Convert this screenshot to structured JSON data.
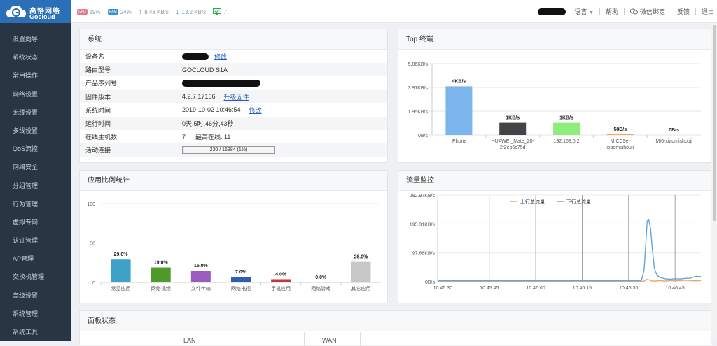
{
  "brand": {
    "name_cn": "高恪网络",
    "name_en": "Gocloud"
  },
  "header_stats": {
    "cpu_badge": "CPU",
    "cpu": "19%",
    "ram_badge": "RAM",
    "ram": "24%",
    "upload": "8.43 KB/s",
    "download": "13.2 KB/s",
    "hosts": "7"
  },
  "top_nav": {
    "language": "语言",
    "help": "帮助",
    "wechat": "微信绑定",
    "feedback": "反馈",
    "logout": "退出"
  },
  "sidebar": {
    "items": [
      "设置向导",
      "系统状态",
      "常用操作",
      "网络设置",
      "无线设置",
      "多线设置",
      "QoS流控",
      "网络安全",
      "分组管理",
      "行为管理",
      "虚拟专网",
      "认证管理",
      "AP管理",
      "交换机管理",
      "高级设置",
      "系统管理",
      "系统工具"
    ]
  },
  "system_panel": {
    "title": "系统",
    "rows": [
      {
        "key": "设备名",
        "value": "",
        "link": "修改"
      },
      {
        "key": "路由型号",
        "value": "GOCLOUD S1A"
      },
      {
        "key": "产品序列号",
        "value": ""
      },
      {
        "key": "固件版本",
        "value": "4.2.7.17166",
        "link": "升级固件"
      },
      {
        "key": "系统时间",
        "value": "2019-10-02 10:46:54",
        "link": "修改"
      },
      {
        "key": "运行时间",
        "value": "0天,5时,46分,43秒"
      },
      {
        "key": "在线主机数",
        "value": "7",
        "extra": "最高在线: 11"
      },
      {
        "key": "活动连接",
        "value": "230 / 16384 (1%)",
        "progress": 0.014
      }
    ]
  },
  "top_terminals": {
    "title": "Top 终端",
    "chart_data": {
      "type": "bar",
      "categories": [
        "iPhone",
        "HUAWEI_Mate_20-2f2eb6c75d",
        "192.168.0.2",
        "MICC9e-xiaomishouji",
        "MI6-xiaomishouji"
      ],
      "category_lines": [
        [
          "iPhone"
        ],
        [
          "HUAWEI_Mate_20-",
          "2f2eb6c75d"
        ],
        [
          "192.168.0.2"
        ],
        [
          "MICC9e-",
          "xiaomishouji"
        ],
        [
          "MI6-xiaomishouji"
        ]
      ],
      "values": [
        4,
        1,
        1,
        0.057,
        0
      ],
      "data_labels": [
        "4KB/s",
        "1KB/s",
        "1KB/s",
        "58B/s",
        "0B/s"
      ],
      "yticks": [
        "0B/s",
        "1.95KB/s",
        "3.91KB/s",
        "5.86KB/s"
      ],
      "ylim": [
        0,
        5.86
      ],
      "colors": [
        "#7cb5ec",
        "#434348",
        "#90ed7d",
        "#f7a35c",
        "#8085e9"
      ]
    }
  },
  "app_stats": {
    "title": "应用比例统计",
    "chart_data": {
      "type": "bar",
      "categories": [
        "常见应用",
        "网络视频",
        "文件传输",
        "网络电视",
        "手机应用",
        "网络游戏",
        "其它应用"
      ],
      "values": [
        29.0,
        19.0,
        15.0,
        7.0,
        4.0,
        0.0,
        26.0
      ],
      "data_labels": [
        "29.0%",
        "19.0%",
        "15.0%",
        "7.0%",
        "4.0%",
        "0.0%",
        "26.0%"
      ],
      "yticks": [
        "0",
        "50",
        "100"
      ],
      "ylim": [
        0,
        100
      ],
      "colors": [
        "#3ea1c7",
        "#4e9a2a",
        "#9b5bbf",
        "#2d5fae",
        "#c0393b",
        "#999999",
        "#c7c7c7"
      ]
    }
  },
  "traffic": {
    "title": "流量监控",
    "chart_data": {
      "type": "line",
      "legend": [
        "上行总流量",
        "下行总流量"
      ],
      "legend_placement": "top-center",
      "x_ticks": [
        "10:45:30",
        "10:45:45",
        "10:46:00",
        "10:46:15",
        "10:46:30",
        "10:46:45"
      ],
      "yticks": [
        "0B/s",
        "97.66KB/s",
        "195.31KB/s",
        "292.97KB/s"
      ],
      "ylim": [
        0,
        292.97
      ],
      "series": [
        {
          "name": "上行总流量",
          "color": "#f7a35c",
          "x": [
            0,
            3,
            6,
            9,
            12,
            15,
            18,
            21,
            24,
            27,
            30,
            33,
            36,
            39,
            42,
            45,
            48,
            51,
            54,
            57,
            60,
            63,
            66,
            69,
            72,
            75,
            78,
            80,
            81,
            82,
            83,
            84,
            85,
            86,
            87,
            88,
            89,
            90,
            92,
            94,
            96,
            98,
            100,
            102
          ],
          "y": [
            0,
            0,
            0,
            0,
            0,
            0,
            0,
            0,
            0,
            0,
            0,
            0,
            0,
            0,
            0,
            0,
            0,
            0,
            0,
            0,
            0,
            0,
            0,
            0,
            0,
            0,
            0,
            2,
            8,
            6,
            3,
            2,
            3,
            4,
            3,
            2,
            3,
            4,
            3,
            4,
            5,
            4,
            3,
            4
          ]
        },
        {
          "name": "下行总流量",
          "color": "#5fa7dd",
          "x": [
            0,
            3,
            6,
            9,
            12,
            15,
            18,
            21,
            24,
            27,
            30,
            33,
            36,
            39,
            42,
            45,
            48,
            51,
            54,
            57,
            60,
            63,
            66,
            69,
            72,
            75,
            78,
            79,
            80,
            80.6,
            81.2,
            81.8,
            82.5,
            83.2,
            84,
            85,
            86,
            88,
            90,
            92,
            94,
            96,
            98,
            100,
            102
          ],
          "y": [
            3,
            3,
            3,
            3,
            3,
            3,
            3,
            3,
            3,
            3,
            3,
            3,
            3,
            3,
            3,
            3,
            3,
            3,
            3,
            3,
            3,
            3,
            3,
            3,
            3,
            3,
            3,
            5,
            40,
            120,
            205,
            210,
            180,
            110,
            45,
            22,
            15,
            10,
            8,
            10,
            9,
            11,
            12,
            18,
            17
          ]
        }
      ]
    }
  },
  "panel_status": {
    "title": "面板状态",
    "lan": "LAN",
    "wan": "WAN"
  }
}
